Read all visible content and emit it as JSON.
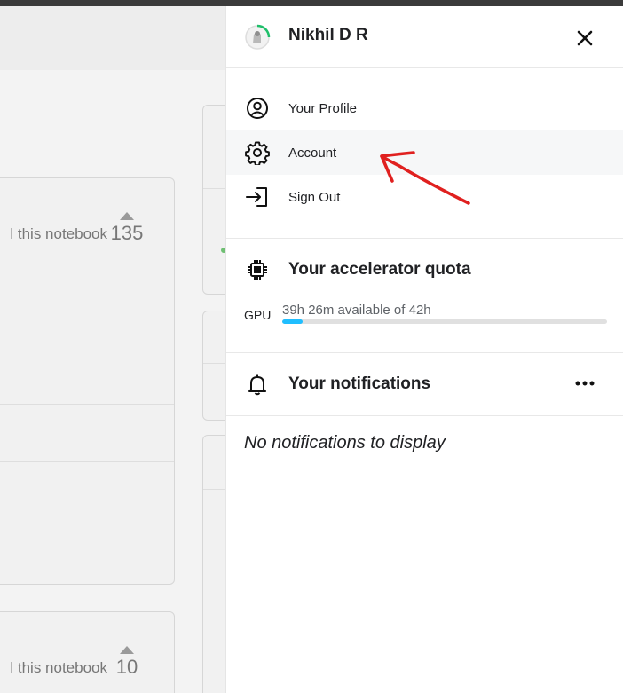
{
  "background": {
    "cards": [
      {
        "snippet": "l this notebook",
        "votes": "135"
      },
      {
        "snippet": "l this notebook",
        "votes": "10"
      }
    ]
  },
  "user_panel": {
    "user_name": "Nikhil D R",
    "menu_items": [
      {
        "label": "Your Profile",
        "icon": "user-circle-icon"
      },
      {
        "label": "Account",
        "icon": "gear-icon"
      },
      {
        "label": "Sign Out",
        "icon": "sign-out-icon"
      }
    ],
    "quota": {
      "title": "Your accelerator quota",
      "icon": "chip-icon",
      "resource": "GPU",
      "text": "39h 26m available of 42h",
      "used_fraction": 0.064
    },
    "notifications": {
      "title": "Your notifications",
      "icon": "bell-icon",
      "empty_text": "No notifications to display"
    }
  },
  "colors": {
    "quota_fill": "#20beff",
    "annotation_arrow": "#e0201f",
    "avatar_ring": "#1fbf6a"
  }
}
